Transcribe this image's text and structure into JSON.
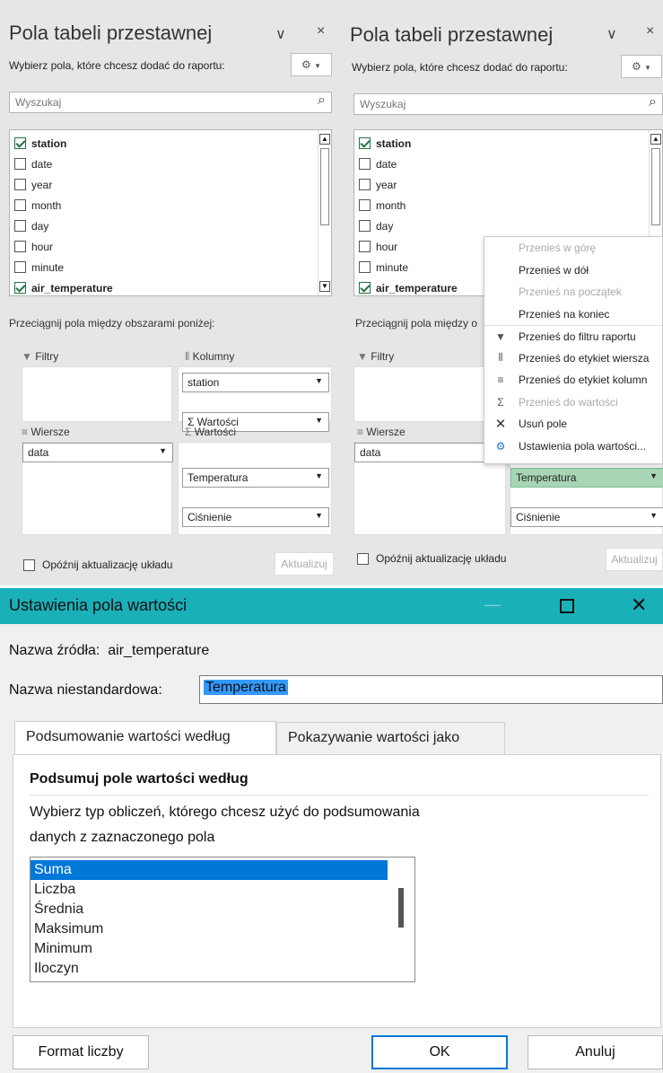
{
  "left_pane": {
    "title": "Pola tabeli przestawnej",
    "subtitle": "Wybierz pola, które chcesz dodać do raportu:",
    "search_placeholder": "Wyszukaj",
    "fields": [
      {
        "label": "station",
        "checked": true
      },
      {
        "label": "date",
        "checked": false
      },
      {
        "label": "year",
        "checked": false
      },
      {
        "label": "month",
        "checked": false
      },
      {
        "label": "day",
        "checked": false
      },
      {
        "label": "hour",
        "checked": false
      },
      {
        "label": "minute",
        "checked": false
      },
      {
        "label": "air_temperature",
        "checked": true
      }
    ],
    "drag_label": "Przeciągnij pola między obszarami poniżej:",
    "filters_label": "Filtry",
    "columns_label": "Kolumny",
    "rows_label": "Wiersze",
    "values_label": "Wartości",
    "columns_items": [
      "station",
      "Σ Wartości"
    ],
    "rows_items": [
      "data"
    ],
    "values_items": [
      "Temperatura",
      "Ciśnienie"
    ],
    "delay_label": "Opóźnij aktualizację układu",
    "update_label": "Aktualizuj"
  },
  "right_pane": {
    "title": "Pola tabeli przestawnej",
    "subtitle": "Wybierz pola, które chcesz dodać do raportu:",
    "search_placeholder": "Wyszukaj",
    "fields": [
      {
        "label": "station",
        "checked": true
      },
      {
        "label": "date",
        "checked": false
      },
      {
        "label": "year",
        "checked": false
      },
      {
        "label": "month",
        "checked": false
      },
      {
        "label": "day",
        "checked": false
      },
      {
        "label": "hour",
        "checked": false
      },
      {
        "label": "minute",
        "checked": false
      },
      {
        "label": "air_temperature",
        "checked": true
      }
    ],
    "drag_label": "Przeciągnij pola między o",
    "filters_label": "Filtry",
    "rows_label": "Wiersze",
    "rows_items": [
      "data"
    ],
    "values_items": [
      "Temperatura",
      "Ciśnienie"
    ],
    "delay_label": "Opóźnij aktualizację układu",
    "update_label": "Aktualizuj"
  },
  "context_menu": [
    {
      "label": "Przenieś w górę",
      "disabled": true,
      "icon": ""
    },
    {
      "label": "Przenieś w dół",
      "disabled": false,
      "icon": ""
    },
    {
      "label": "Przenieś na początek",
      "disabled": true,
      "icon": ""
    },
    {
      "label": "Przenieś na koniec",
      "disabled": false,
      "icon": ""
    },
    {
      "label": "Przenieś do filtru raportu",
      "disabled": false,
      "icon": "filter-icon"
    },
    {
      "label": "Przenieś do etykiet wiersza",
      "disabled": false,
      "icon": "rows-icon"
    },
    {
      "label": "Przenieś do etykiet kolumn",
      "disabled": false,
      "icon": "columns-icon"
    },
    {
      "label": "Przenieś do wartości",
      "disabled": true,
      "icon": "sigma-icon"
    },
    {
      "label": "Usuń pole",
      "disabled": false,
      "icon": "x-icon"
    },
    {
      "label": "Ustawienia pola wartości...",
      "disabled": false,
      "icon": "settings-icon"
    }
  ],
  "dialog": {
    "title": "Ustawienia pola wartości",
    "source_label": "Nazwa źródła:",
    "source_value": "air_temperature",
    "custom_name_label": "Nazwa niestandardowa:",
    "custom_name_value": "Temperatura",
    "tabs": [
      "Podsumowanie wartości według",
      "Pokazywanie wartości jako"
    ],
    "section_title": "Podsumuj pole wartości według",
    "description_line1": "Wybierz typ obliczeń, którego chcesz użyć do podsumowania",
    "description_line2": "danych z zaznaczonego pola",
    "functions": [
      "Suma",
      "Liczba",
      "Średnia",
      "Maksimum",
      "Minimum",
      "Iloczyn"
    ],
    "selected_function": "Suma",
    "number_format_label": "Format liczby",
    "ok_label": "OK",
    "cancel_label": "Anuluj",
    "titlebar_color": "#1ab0b8"
  }
}
